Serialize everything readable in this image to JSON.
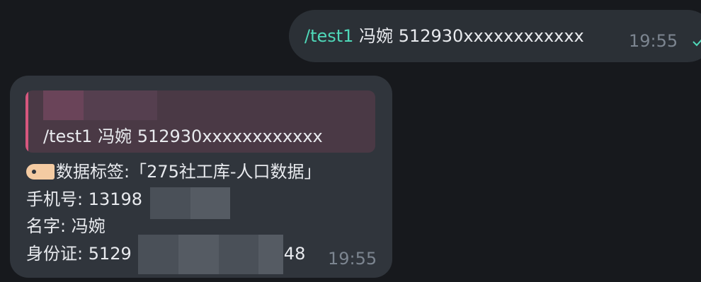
{
  "outgoing": {
    "command": "/test1",
    "text": " 冯婉 512930xxxxxxxxxxxx",
    "time": "19:55",
    "status_icon": "check-icon"
  },
  "incoming": {
    "reply": {
      "text": "/test1 冯婉 512930xxxxxxxxxxxx"
    },
    "tag_icon": "label-tag-icon",
    "lines": {
      "tag": "数据标签:「275社工库-人口数据」",
      "phone": "手机号: 13198",
      "name": "名字: 冯婉",
      "id_prefix": "身份证: 5129",
      "id_suffix": "48"
    },
    "time": "19:55"
  },
  "colors": {
    "background": "#17191d",
    "bubble": "#30353c",
    "command": "#4fd8b9",
    "reply_accent": "#d6577e"
  }
}
